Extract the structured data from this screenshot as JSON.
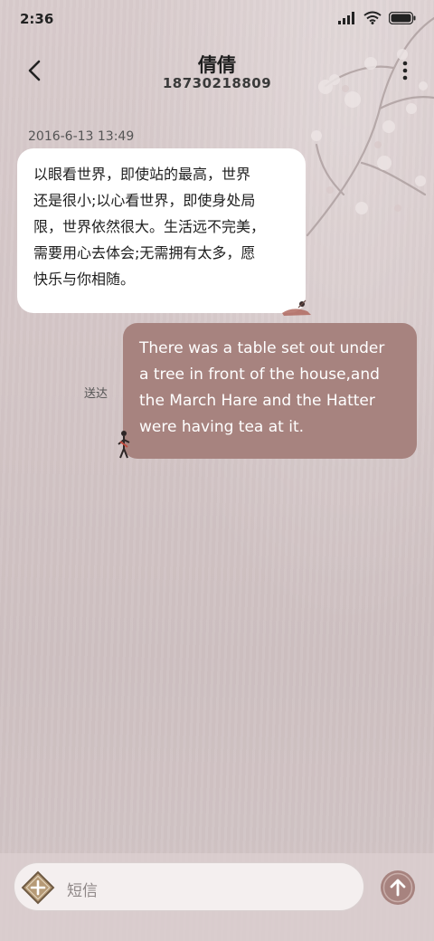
{
  "status_bar": {
    "time": "2:36"
  },
  "header": {
    "contact_name": "倩倩",
    "contact_number": "18730218809"
  },
  "conversation": {
    "timestamp": "2016-6-13 13:49",
    "incoming_lines": [
      "以眼看世界，即使站的最高，世界",
      "还是很小;以心看世界，即使身处局",
      "限，世界依然很大。生活远不完美，",
      "需要用心去体会;无需拥有太多，愿",
      "快乐与你相随。"
    ],
    "outgoing_lines": [
      "There was a table set out under",
      "a tree in front of the house,and",
      "the March Hare and the Hatter",
      "were having tea at it."
    ],
    "outgoing_status": "送达"
  },
  "composer": {
    "placeholder": "短信"
  },
  "icons": {
    "back": "back-arrow-icon",
    "more": "more-vertical-icon",
    "attach": "plus-icon",
    "send": "send-arrow-up-icon",
    "signal": "signal-icon",
    "wifi": "wifi-icon",
    "battery": "battery-icon"
  },
  "colors": {
    "outgoing_bubble": "#a7837f",
    "incoming_bubble": "#ffffff",
    "background": "#d4c6c7",
    "send_button": "#a7837f"
  }
}
